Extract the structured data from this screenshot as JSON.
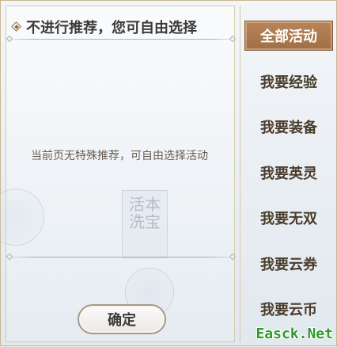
{
  "panel": {
    "title": "不进行推荐，您可自由选择",
    "message": "当前页无特殊推荐，可自由选择活动",
    "confirm_label": "确定",
    "seal_text": "活本\n洗宝"
  },
  "tabs": [
    {
      "label": "全部活动",
      "active": true
    },
    {
      "label": "我要经验",
      "active": false
    },
    {
      "label": "我要装备",
      "active": false
    },
    {
      "label": "我要英灵",
      "active": false
    },
    {
      "label": "我要无双",
      "active": false
    },
    {
      "label": "我要云券",
      "active": false
    },
    {
      "label": "我要云币",
      "active": false
    }
  ],
  "watermark": "Easck.Net",
  "colors": {
    "active_tab": "#a97a50",
    "tab_text": "#4a3c2c",
    "border_gold": "#d8cba9",
    "watermark": "#2e9a2e"
  }
}
